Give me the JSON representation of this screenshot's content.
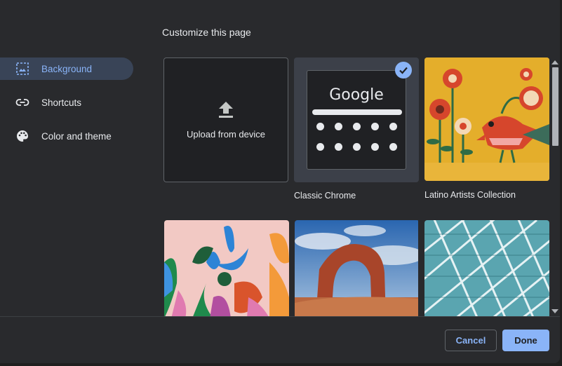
{
  "dialog": {
    "title": "Customize this page"
  },
  "sidebar": {
    "items": [
      {
        "label": "Background",
        "icon": "background-icon",
        "active": true
      },
      {
        "label": "Shortcuts",
        "icon": "link-icon",
        "active": false
      },
      {
        "label": "Color and theme",
        "icon": "palette-icon",
        "active": false
      }
    ]
  },
  "backgrounds": {
    "upload_label": "Upload from device",
    "classic": {
      "logo": "Google",
      "caption": "Classic Chrome",
      "selected": true
    },
    "collections": [
      {
        "caption": "Latino Artists Collection",
        "image": "folk-art-flowers-bird"
      },
      {
        "caption": "",
        "image": "colorful-floral-illustration"
      },
      {
        "caption": "",
        "image": "desert-rock-arch"
      },
      {
        "caption": "",
        "image": "teal-geometric-architecture"
      }
    ]
  },
  "footer": {
    "cancel_label": "Cancel",
    "done_label": "Done"
  },
  "colors": {
    "accent": "#8ab4f8",
    "dialog_bg": "#292a2d",
    "active_nav_bg": "#394457",
    "text": "#e8eaed"
  }
}
